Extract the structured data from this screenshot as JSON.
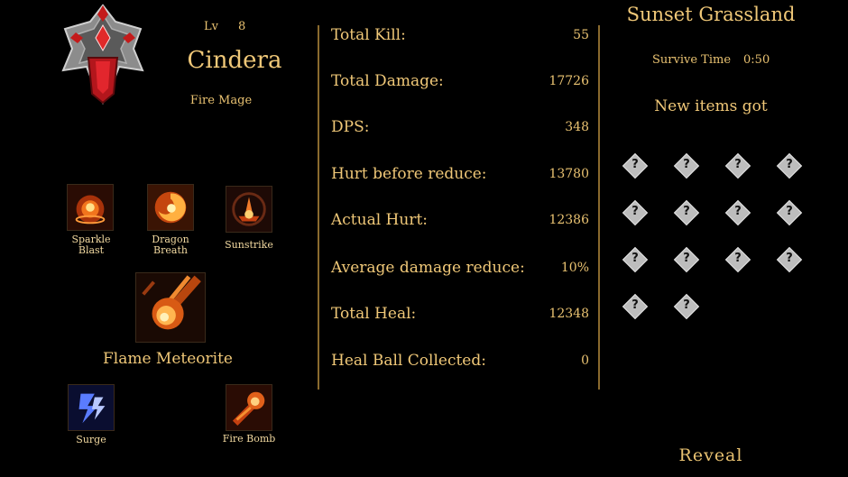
{
  "hero": {
    "level_label": "Lv",
    "level": "8",
    "name": "Cindera",
    "class": "Fire Mage"
  },
  "skills": {
    "sparkle_blast": "Sparkle\nBlast",
    "dragon_breath": "Dragon\nBreath",
    "sunstrike": "Sunstrike",
    "flame_meteorite": "Flame Meteorite",
    "surge": "Surge",
    "fire_bomb": "Fire Bomb"
  },
  "stats": [
    {
      "label": "Total Kill:",
      "value": "55"
    },
    {
      "label": "Total Damage:",
      "value": "17726"
    },
    {
      "label": "DPS:",
      "value": "348"
    },
    {
      "label": "Hurt before reduce:",
      "value": "13780"
    },
    {
      "label": "Actual Hurt:",
      "value": "12386"
    },
    {
      "label": "Average damage reduce:",
      "value": "10%"
    },
    {
      "label": "Total Heal:",
      "value": "12348"
    },
    {
      "label": "Heal Ball Collected:",
      "value": "0"
    }
  ],
  "result": {
    "map_name": "Sunset Grassland",
    "survive_label": "Survive Time",
    "survive_time": "0:50",
    "new_items_label": "New items got",
    "unknown_item_glyph": "?",
    "item_count": 14,
    "reveal_label": "Reveal"
  },
  "colors": {
    "background": "#000000",
    "gold_text": "#e9c271",
    "divider": "#8a6a2e",
    "item_tile": "#bdbdbd"
  }
}
